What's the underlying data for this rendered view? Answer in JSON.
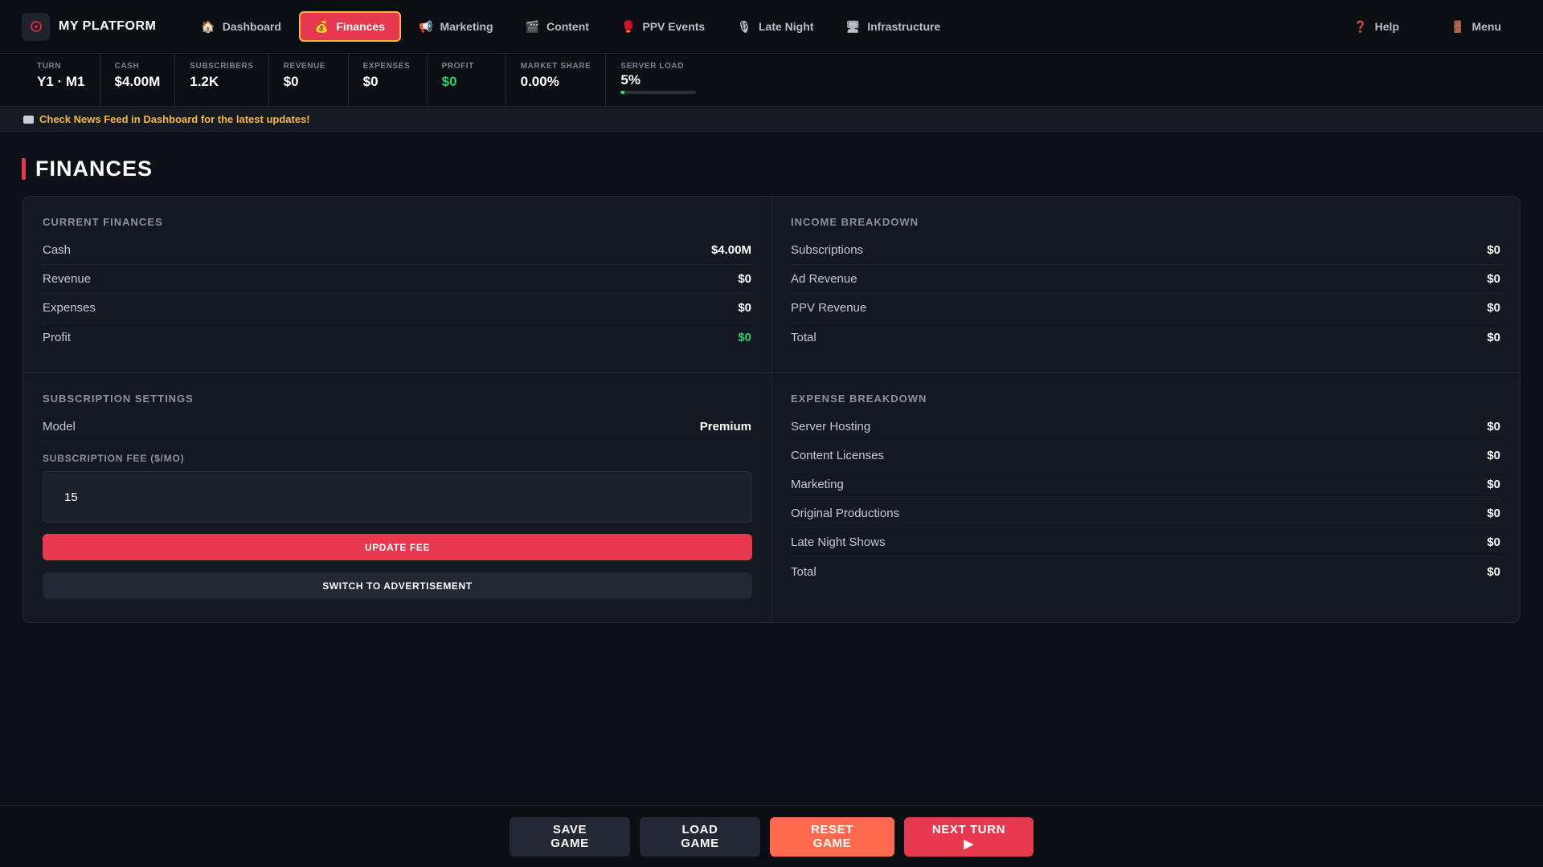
{
  "brand": {
    "name": "MY PLATFORM",
    "logo_icon": "record-icon"
  },
  "nav": {
    "items": [
      {
        "label": "Dashboard",
        "icon": "🏠"
      },
      {
        "label": "Finances",
        "icon": "💰",
        "active": true
      },
      {
        "label": "Marketing",
        "icon": "📢"
      },
      {
        "label": "Content",
        "icon": "🎬"
      },
      {
        "label": "PPV Events",
        "icon": "🥊"
      },
      {
        "label": "Late Night",
        "icon": "🎙"
      },
      {
        "label": "Infrastructure",
        "icon": "🖥"
      }
    ],
    "help": {
      "label": "Help",
      "icon": "❓"
    },
    "menu": {
      "label": "Menu",
      "icon": "🚪"
    }
  },
  "stats": {
    "turn": {
      "label": "TURN",
      "value": "Y1 · M1"
    },
    "cash": {
      "label": "CASH",
      "value": "$4.00M"
    },
    "subscribers": {
      "label": "SUBSCRIBERS",
      "value": "1.2K"
    },
    "revenue": {
      "label": "REVENUE",
      "value": "$0"
    },
    "expenses": {
      "label": "EXPENSES",
      "value": "$0"
    },
    "profit": {
      "label": "PROFIT",
      "value": "$0"
    },
    "market_share": {
      "label": "MARKET SHARE",
      "value": "0.00%"
    },
    "server_load": {
      "label": "SERVER LOAD",
      "value": "5%",
      "fraction": 0.05
    }
  },
  "news": {
    "text": "Check News Feed in Dashboard for the latest updates!"
  },
  "page": {
    "title": "FINANCES"
  },
  "current_finances": {
    "title": "CURRENT FINANCES",
    "rows": [
      {
        "label": "Cash",
        "value": "$4.00M"
      },
      {
        "label": "Revenue",
        "value": "$0"
      },
      {
        "label": "Expenses",
        "value": "$0"
      },
      {
        "label": "Profit",
        "value": "$0"
      }
    ]
  },
  "income_breakdown": {
    "title": "INCOME BREAKDOWN",
    "rows": [
      {
        "label": "Subscriptions",
        "value": "$0"
      },
      {
        "label": "Ad Revenue",
        "value": "$0"
      },
      {
        "label": "PPV Revenue",
        "value": "$0"
      },
      {
        "label": "Total",
        "value": "$0"
      }
    ]
  },
  "subscription_settings": {
    "title": "SUBSCRIPTION SETTINGS",
    "model_label": "Model",
    "model_value": "Premium",
    "fee_label": "SUBSCRIPTION FEE ($/MO)",
    "fee_value": "15",
    "update_button": "UPDATE FEE",
    "switch_button": "SWITCH TO ADVERTISEMENT"
  },
  "expense_breakdown": {
    "title": "EXPENSE BREAKDOWN",
    "rows": [
      {
        "label": "Server Hosting",
        "value": "$0"
      },
      {
        "label": "Content Licenses",
        "value": "$0"
      },
      {
        "label": "Marketing",
        "value": "$0"
      },
      {
        "label": "Original Productions",
        "value": "$0"
      },
      {
        "label": "Late Night Shows",
        "value": "$0"
      },
      {
        "label": "Total",
        "value": "$0"
      }
    ]
  },
  "footer": {
    "save": "SAVE GAME",
    "load": "LOAD GAME",
    "reset": "RESET GAME",
    "next": "NEXT TURN ▶"
  },
  "colors": {
    "accent": "#e63950",
    "active_border": "#f5b73c",
    "positive": "#2ecc71",
    "reset": "#ff6a4f",
    "news": "#f5b73c"
  }
}
